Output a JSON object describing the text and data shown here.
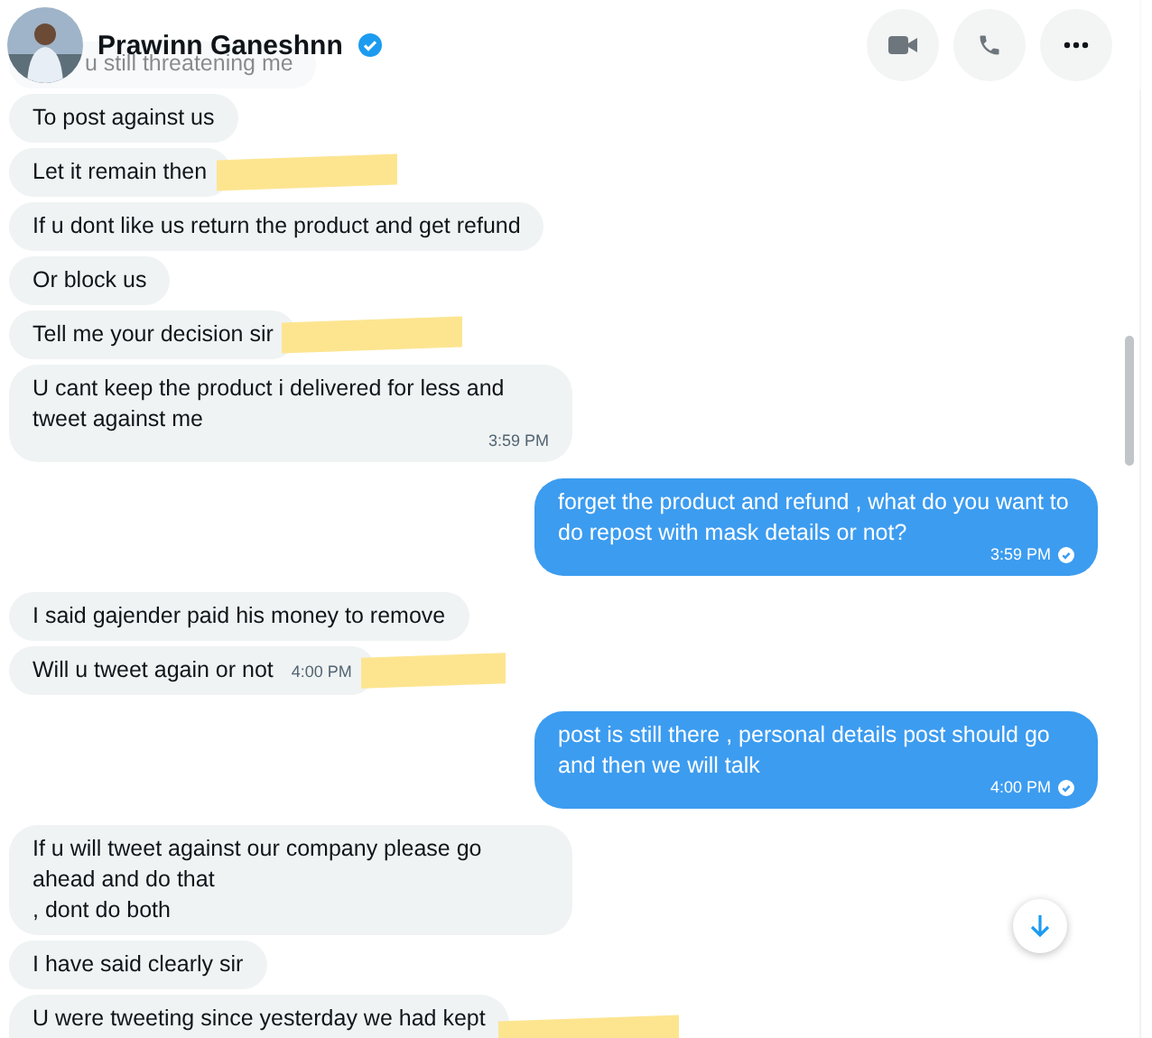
{
  "header": {
    "name": "Prawinn Ganeshnn",
    "verified": true
  },
  "messages": [
    {
      "kind": "received",
      "text": "u still threatening me"
    },
    {
      "kind": "received",
      "text": "To post against us"
    },
    {
      "kind": "received",
      "text": "Let it remain then",
      "redacted": true
    },
    {
      "kind": "received",
      "text": "If u dont like us return the product and get refund"
    },
    {
      "kind": "received",
      "text": "Or block us"
    },
    {
      "kind": "received",
      "text": "Tell me your decision sir",
      "redacted": true
    },
    {
      "kind": "received",
      "text": "U cant keep the product i delivered for less and tweet against me",
      "time": "3:59 PM"
    },
    {
      "kind": "sent",
      "text": "forget the product and refund , what do you want to do repost with mask details or not?",
      "time": "3:59 PM",
      "read": true
    },
    {
      "kind": "received",
      "text": "I said gajender paid his money to remove"
    },
    {
      "kind": "received",
      "text": "Will u tweet again or not",
      "time": "4:00 PM",
      "redacted": true
    },
    {
      "kind": "sent",
      "text": "post is still there , personal details post should go and then we will talk",
      "time": "4:00 PM",
      "read": true
    },
    {
      "kind": "received",
      "text": "If u will tweet against our company please go ahead and do that\n, dont do both"
    },
    {
      "kind": "received",
      "text": "I have said clearly sir"
    },
    {
      "kind": "received",
      "text": "U were tweeting since yesterday we had kept",
      "redacted": true
    }
  ]
}
